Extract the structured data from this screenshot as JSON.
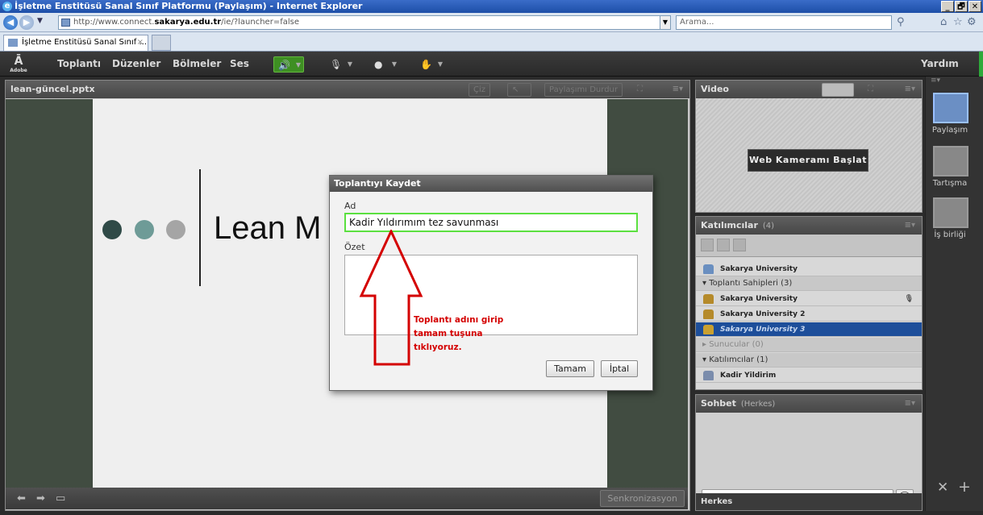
{
  "browser": {
    "title": "İşletme Enstitüsü Sanal Sınıf Platformu (Paylaşım) - Internet Explorer",
    "url_pre": "http://www.connect.",
    "url_host": "sakarya.edu.tr",
    "url_post": "/ie/?launcher=false",
    "search_placeholder": "Arama...",
    "tab_label": "İşletme Enstitüsü Sanal Sınıf ...",
    "window_buttons": [
      "_",
      "🗗",
      "✕"
    ]
  },
  "menubar": {
    "logo": "Adobe",
    "items": [
      "Toplantı",
      "Düzenler",
      "Bölmeler",
      "Ses"
    ],
    "help": "Yardım"
  },
  "share_pod": {
    "title": "lean-güncel.pptx",
    "draw_label": "Çiz",
    "stop_share_label": "Paylaşımı Durdur",
    "slide_text": "Lean M",
    "slide_dot_colors": [
      "#2f4a47",
      "#6e9b97",
      "#a5a5a5"
    ],
    "sync_label": "Senkronizasyon"
  },
  "video_pod": {
    "title": "Video",
    "start_webcam_label": "Web Kameramı Başlat"
  },
  "attendees_pod": {
    "title": "Katılımcılar",
    "count": "(4)",
    "rows": [
      {
        "kind": "person",
        "label": "Sakarya University",
        "selected": false
      },
      {
        "kind": "group",
        "label": "Toplantı Sahipleri (3)",
        "muted": false
      },
      {
        "kind": "person",
        "label": "Sakarya University",
        "selected": false
      },
      {
        "kind": "person",
        "label": "Sakarya University 2",
        "selected": false
      },
      {
        "kind": "person",
        "label": "Sakarya University 3",
        "selected": true
      },
      {
        "kind": "group",
        "label": "Sunucular (0)",
        "muted": true
      },
      {
        "kind": "group",
        "label": "Katılımcılar (1)",
        "muted": false
      },
      {
        "kind": "person",
        "label": "Kadir Yildirim",
        "selected": false
      }
    ]
  },
  "chat_pod": {
    "title": "Sohbet",
    "scope": "(Herkes)",
    "to_label": "Herkes"
  },
  "layouts": {
    "items": [
      "Paylaşım",
      "Tartışma",
      "İş birliği"
    ]
  },
  "dialog": {
    "title": "Toplantıyı Kaydet",
    "name_label": "Ad",
    "name_value": "Kadir Yıldırımım tez savunması",
    "summary_label": "Özet",
    "ok_label": "Tamam",
    "cancel_label": "İptal"
  },
  "annotation": {
    "text_line1": "Toplantı adını girip",
    "text_line2": "tamam tuşuna",
    "text_line3": "tıklıyoruz.",
    "color": "#d40000"
  }
}
